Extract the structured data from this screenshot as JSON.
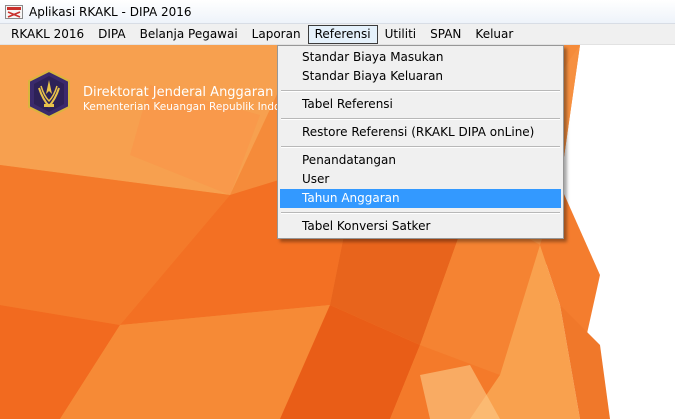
{
  "window": {
    "title": "Aplikasi RKAKL - DIPA 2016",
    "icon": "app-icon"
  },
  "menubar": {
    "items": [
      {
        "label": "RKAKL 2016"
      },
      {
        "label": "DIPA"
      },
      {
        "label": "Belanja Pegawai"
      },
      {
        "label": "Laporan"
      },
      {
        "label": "Referensi",
        "active": true
      },
      {
        "label": "Utiliti"
      },
      {
        "label": "SPAN"
      },
      {
        "label": "Keluar"
      }
    ]
  },
  "brand": {
    "title": "Direktorat Jenderal Anggaran",
    "subtitle": "Kementerian Keuangan Republik Indonesia",
    "logo": "kemenkeu-logo"
  },
  "dropdown": {
    "items": [
      {
        "label": "Standar Biaya Masukan"
      },
      {
        "label": "Standar Biaya Keluaran"
      },
      {
        "label": "Tabel Referensi"
      },
      {
        "label": "Restore Referensi (RKAKL DIPA onLine)"
      },
      {
        "label": "Penandatangan"
      },
      {
        "label": "User"
      },
      {
        "label": "Tahun Anggaran",
        "highlighted": true
      },
      {
        "label": "Tabel Konversi Satker"
      }
    ]
  },
  "colors": {
    "background_orange": "#f47a2a",
    "menu_highlight": "#3399ff",
    "menu_bg": "#f0f0f0"
  }
}
